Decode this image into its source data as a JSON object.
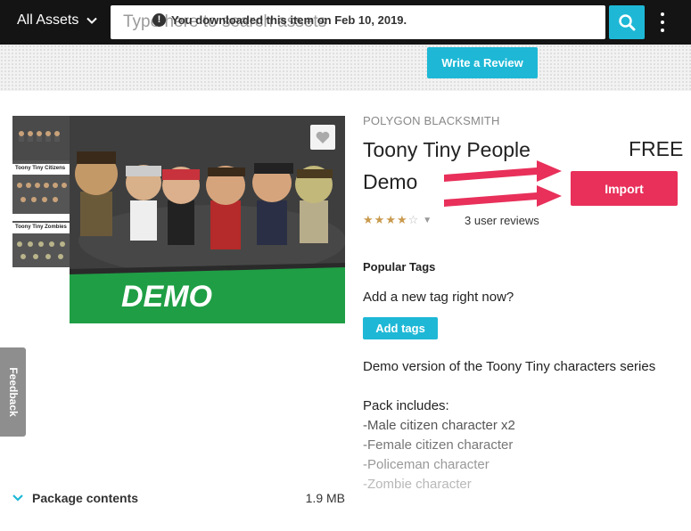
{
  "topbar": {
    "assets_dropdown": "All Assets",
    "search_placeholder": "Type here to search assets",
    "search_value": ""
  },
  "notice": {
    "text": "You downloaded this item on Feb 10, 2019.",
    "review_button": "Write a Review"
  },
  "media": {
    "thumbnails": [
      {
        "label": ""
      },
      {
        "label": "Toony Tiny Citizens"
      },
      {
        "label": "Toony Tiny Zombies"
      }
    ],
    "main_banner_text": "DEMO"
  },
  "product": {
    "publisher": "POLYGON BLACKSMITH",
    "title": "Toony Tiny People Demo",
    "price": "FREE",
    "import_button": "Import",
    "rating": 4,
    "rating_max": 5,
    "reviews_link": "3 user reviews",
    "popular_tags_heading": "Popular Tags",
    "add_tag_prompt": "Add a new tag right now?",
    "add_tags_button": "Add tags",
    "description": "Demo version of the Toony Tiny characters series",
    "pack_heading": "Pack includes:",
    "pack_items": [
      "-Male citizen character x2",
      "-Female citizen character",
      "-Policeman character",
      "-Zombie character"
    ]
  },
  "feedback_tab": "Feedback",
  "package_contents": {
    "label": "Package contents",
    "size": "1.9 MB"
  },
  "colors": {
    "accent_blue": "#1eb8d6",
    "import_red": "#e8305a",
    "topbar_bg": "#141414",
    "arrow_red": "#e8305a"
  }
}
